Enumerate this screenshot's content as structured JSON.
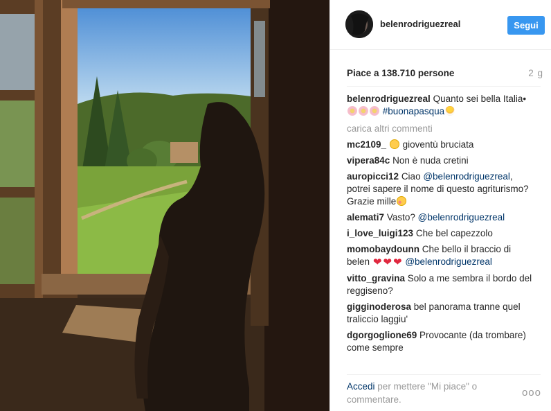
{
  "post": {
    "username": "belenrodriguezreal",
    "follow_label": "Segui",
    "likes_text": "Piace a 138.710 persone",
    "time_ago": "2 g",
    "load_more": "carica altri commenti",
    "caption": {
      "user": "belenrodriguezreal",
      "text_1": "Quanto sei bella Italia•",
      "hashtag": "#buonapasqua"
    },
    "comments": [
      {
        "user": "mc2109_",
        "text": "gioventù bruciata"
      },
      {
        "user": "vipera84c",
        "text": "Non è nuda cretini"
      },
      {
        "user": "auropicci12",
        "text_before": "Ciao",
        "mention": "@belenrodriguezreal",
        "text_after": ", potrei sapere il nome di questo agriturismo? Grazie mille"
      },
      {
        "user": "alemati7",
        "text": "Vasto?",
        "mention": "@belenrodriguezreal"
      },
      {
        "user": "i_love_luigi123",
        "text": "Che bel capezzolo"
      },
      {
        "user": "momobaydounn",
        "text": "Che bello il braccio di belen",
        "mention": "@belenrodriguezreal"
      },
      {
        "user": "vitto_gravina",
        "text": "Solo a me sembra il bordo del reggiseno?"
      },
      {
        "user": "gigginoderosa",
        "text": "bel panorama tranne quel traliccio laggiu'"
      },
      {
        "user": "dgorgoglione69",
        "text": "Provocante (da trombare) come sempre"
      }
    ],
    "login_link": "Accedi",
    "login_rest": "per mettere \"Mi piace\" o commentare.",
    "more_options": "ooo"
  },
  "colors": {
    "link": "#003569",
    "accent": "#3897f0",
    "muted": "#999999",
    "heart": "#e0283f"
  },
  "icons": {
    "avatar": "profile-photo",
    "flowers": "blossom-emoji",
    "egg": "hatching-chick-emoji",
    "sad": "sad-face-emoji",
    "blush": "blush-face-emoji",
    "hearts": "red-heart-emoji"
  }
}
